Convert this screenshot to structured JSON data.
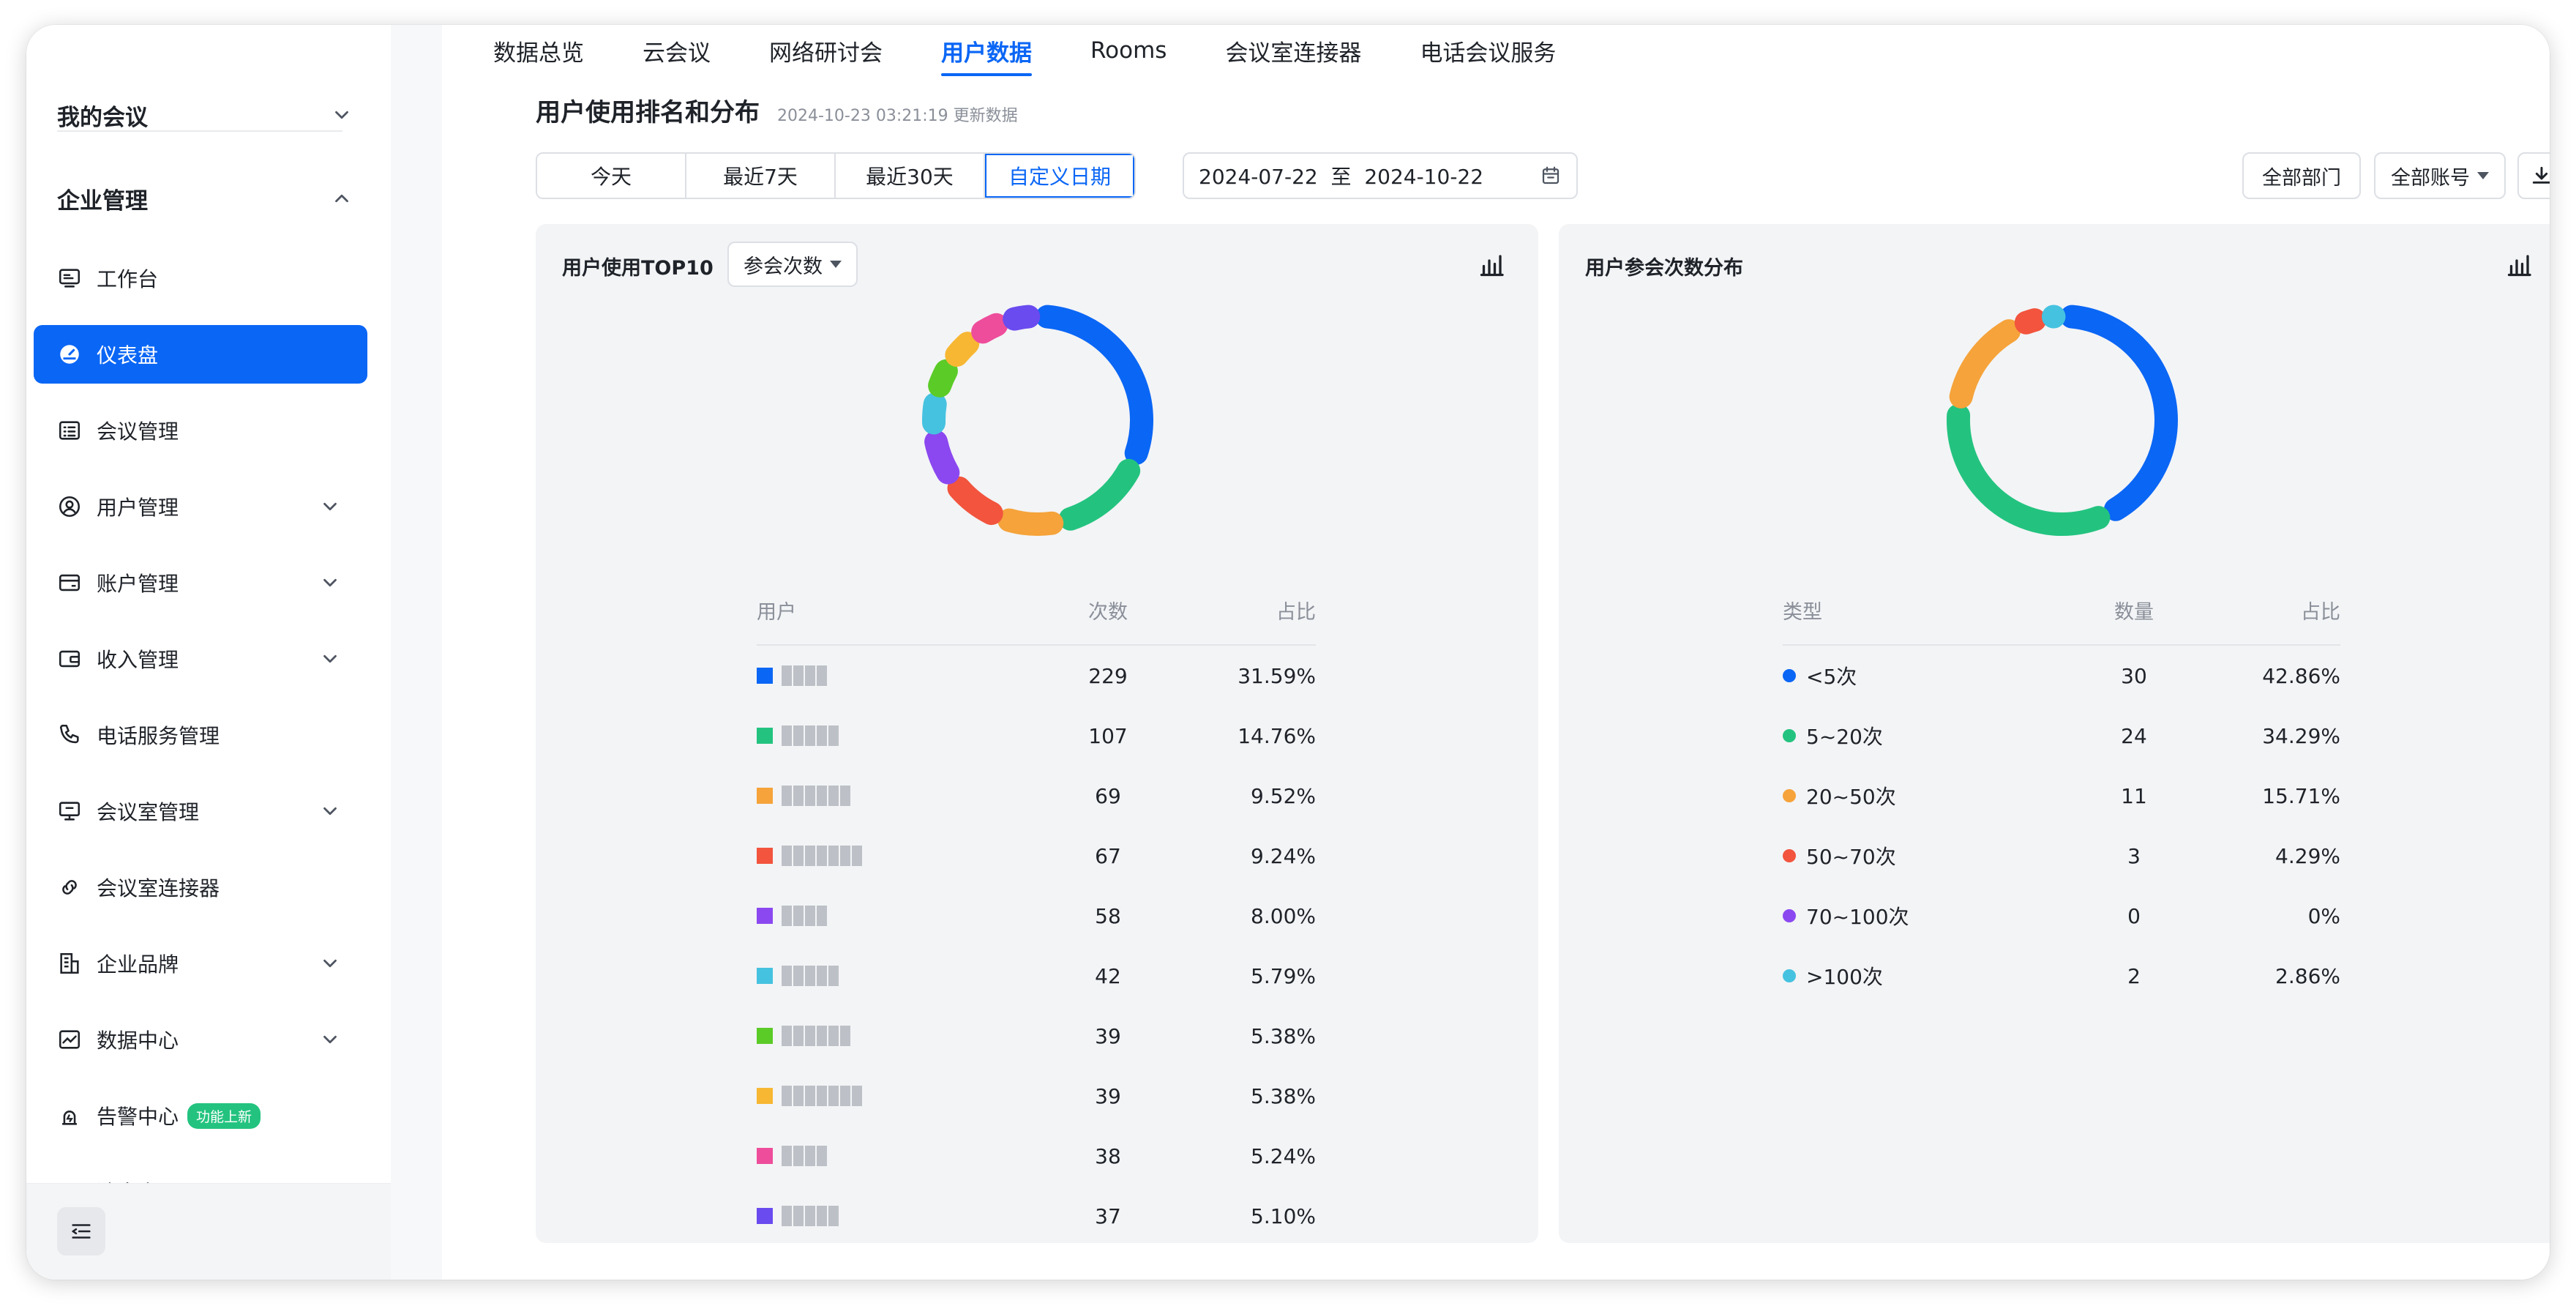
{
  "sidebar": {
    "my_meetings": "我的会议",
    "enterprise": "企业管理",
    "items": [
      {
        "label": "工作台"
      },
      {
        "label": "仪表盘"
      },
      {
        "label": "会议管理"
      },
      {
        "label": "用户管理"
      },
      {
        "label": "账户管理"
      },
      {
        "label": "收入管理"
      },
      {
        "label": "电话服务管理"
      },
      {
        "label": "会议室管理"
      },
      {
        "label": "会议室连接器"
      },
      {
        "label": "企业品牌"
      },
      {
        "label": "数据中心"
      },
      {
        "label": "告警中心",
        "badge": "功能上新"
      },
      {
        "label": "消息中心"
      }
    ]
  },
  "tabs": [
    "数据总览",
    "云会议",
    "网络研讨会",
    "用户数据",
    "Rooms",
    "会议室连接器",
    "电话会议服务"
  ],
  "section": {
    "title": "用户使用排名和分布",
    "timestamp": "2024-10-23 03:21:19 更新数据"
  },
  "ranges": [
    "今天",
    "最近7天",
    "最近30天",
    "自定义日期"
  ],
  "date_range": "2024-07-22  至  2024-10-22",
  "filters": {
    "dept": "全部部门",
    "account": "全部账号"
  },
  "top10": {
    "title": "用户使用TOP10",
    "metric": "参会次数",
    "headers": [
      "用户",
      "次数",
      "占比"
    ],
    "rows": [
      {
        "count": "229",
        "pct": "31.59%"
      },
      {
        "count": "107",
        "pct": "14.76%"
      },
      {
        "count": "69",
        "pct": "9.52%"
      },
      {
        "count": "67",
        "pct": "9.24%"
      },
      {
        "count": "58",
        "pct": "8.00%"
      },
      {
        "count": "42",
        "pct": "5.79%"
      },
      {
        "count": "39",
        "pct": "5.38%"
      },
      {
        "count": "39",
        "pct": "5.38%"
      },
      {
        "count": "38",
        "pct": "5.24%"
      },
      {
        "count": "37",
        "pct": "5.10%"
      }
    ]
  },
  "dist": {
    "title": "用户参会次数分布",
    "headers": [
      "类型",
      "数量",
      "占比"
    ],
    "rows": [
      {
        "type": "<5次",
        "count": "30",
        "pct": "42.86%"
      },
      {
        "type": "5~20次",
        "count": "24",
        "pct": "34.29%"
      },
      {
        "type": "20~50次",
        "count": "11",
        "pct": "15.71%"
      },
      {
        "type": "50~70次",
        "count": "3",
        "pct": "4.29%"
      },
      {
        "type": "70~100次",
        "count": "0",
        "pct": "0%"
      },
      {
        "type": ">100次",
        "count": "2",
        "pct": "2.86%"
      }
    ]
  },
  "chart_data": [
    {
      "type": "pie",
      "series": [
        {
          "values": [
            229,
            107,
            69,
            67,
            58,
            42,
            39,
            39,
            38,
            37
          ]
        }
      ],
      "colors": [
        "#0a66f5",
        "#23c37f",
        "#f5a33a",
        "#f2543d",
        "#8b48f0",
        "#45c2e0",
        "#5bcb28",
        "#f7b733",
        "#ee4d9b",
        "#6a4bef"
      ]
    },
    {
      "type": "pie",
      "categories": [
        "<5次",
        "5~20次",
        "20~50次",
        "50~70次",
        "70~100次",
        ">100次"
      ],
      "series": [
        {
          "values": [
            30,
            24,
            11,
            3,
            0,
            2
          ]
        }
      ],
      "colors": [
        "#0a66f5",
        "#23c37f",
        "#f5a33a",
        "#f2543d",
        "#8b48f0",
        "#45c2e0"
      ]
    }
  ],
  "colors": {
    "accent": "#0a66f5",
    "badge": "#23c37f"
  }
}
